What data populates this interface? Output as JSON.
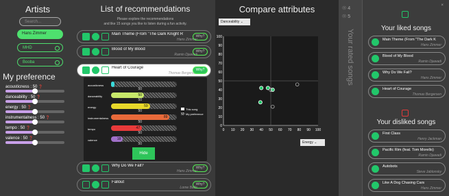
{
  "colors": {
    "accent": "#22c76a",
    "like": "#22c76a",
    "dislike": "#e03a3a",
    "liked_pill": "#22c76a"
  },
  "artists": {
    "title": "Artists",
    "search_placeholder": "Search...",
    "items": [
      {
        "label": "Hans Zimmer",
        "selected": true
      },
      {
        "label": "MHD",
        "selected": false
      },
      {
        "label": "Booba",
        "selected": false
      }
    ]
  },
  "preference": {
    "title": "My preference",
    "sliders": [
      {
        "label": "acousticness : 50",
        "value": 50
      },
      {
        "label": "danceability : 50",
        "value": 50
      },
      {
        "label": "energy : 50",
        "value": 50
      },
      {
        "label": "instrumentalness : 50",
        "value": 50
      },
      {
        "label": "tempo : 50",
        "value": 50
      },
      {
        "label": "valence : 50",
        "value": 50
      }
    ]
  },
  "recommendations": {
    "title": "List of recommendations",
    "intro_line1": "Please explore the recommendations",
    "intro_line2": "and like 15 songs you like to listen during a fun activity.",
    "why_label": "Why?",
    "items": [
      {
        "title": "Main Theme (From \"The Dark Knight R",
        "artist": "Hans Zimmer"
      },
      {
        "title": "Blood of My Blood",
        "artist": "Ramin Djawadi"
      },
      {
        "title": "Heart of Courage",
        "artist": "Thomas Bergersen"
      },
      {
        "title": "Why Do We Fall?",
        "artist": "Hans Zimmer"
      },
      {
        "title": "Fallout",
        "artist": "Lorne Balfe"
      }
    ],
    "detail": {
      "attributes": [
        {
          "name": "acousticness",
          "song": 5,
          "pref": 50,
          "color": "#3ad9d9"
        },
        {
          "name": "danceability",
          "song": 50,
          "pref": 50,
          "color": "#c7e86a"
        },
        {
          "name": "energy",
          "song": 59,
          "pref": 50,
          "color": "#e8d82a"
        },
        {
          "name": "instrumentalness",
          "song": 89,
          "pref": 50,
          "color": "#e86a3a"
        },
        {
          "name": "tempo",
          "song": 47,
          "pref": 50,
          "color": "#e83a3a"
        },
        {
          "name": "valence",
          "song": 18,
          "pref": 50,
          "color": "#a070c8"
        }
      ],
      "legend_song": "This song",
      "legend_pref": "My preference",
      "hide_label": "Hide"
    }
  },
  "compare": {
    "title": "Compare attributes",
    "x_select": "Danceability",
    "y_select": "Energy",
    "chart_data": {
      "type": "scatter",
      "xlim": [
        0,
        100
      ],
      "ylim": [
        0,
        100
      ],
      "xticks": [
        "0",
        "10",
        "20",
        "30",
        "40",
        "50",
        "60",
        "70",
        "80",
        "90",
        "100"
      ],
      "yticks": [
        "0",
        "10",
        "20",
        "30",
        "40",
        "50",
        "60",
        "70",
        "80",
        "90",
        "100"
      ],
      "reference": {
        "x": 50,
        "y": 50
      },
      "points": [
        {
          "x": 40,
          "y": 42,
          "kind": "liked"
        },
        {
          "x": 47,
          "y": 42,
          "kind": "liked"
        },
        {
          "x": 52,
          "y": 40,
          "kind": "liked"
        },
        {
          "x": 39,
          "y": 26,
          "kind": "liked"
        },
        {
          "x": 50,
          "y": 40,
          "kind": "open"
        },
        {
          "x": 78,
          "y": 46,
          "kind": "open"
        },
        {
          "x": 52,
          "y": 21,
          "kind": "open"
        }
      ]
    }
  },
  "rated": {
    "label": "Your rated songs",
    "likes": "4",
    "dislikes": "5"
  },
  "liked": {
    "title": "Your liked songs",
    "items": [
      {
        "title": "Main Theme (From \"The Dark K",
        "artist": "Hans Zimmer"
      },
      {
        "title": "Blood of My Blood",
        "artist": "Ramin Djawadi"
      },
      {
        "title": "Why Do We Fall?",
        "artist": "Hans Zimmer"
      },
      {
        "title": "Heart of Courage",
        "artist": "Thomas Bergersen"
      }
    ]
  },
  "disliked": {
    "title": "Your disliked songs",
    "items": [
      {
        "title": "First Class",
        "artist": "Henry Jackman"
      },
      {
        "title": "Pacific Rim (feat. Tom Morello)",
        "artist": "Ramin Djawadi"
      },
      {
        "title": "Autobots",
        "artist": "Steve Jablonsky"
      },
      {
        "title": "Like A Dog Chasing Cars",
        "artist": "Hans Zimmer"
      }
    ]
  }
}
